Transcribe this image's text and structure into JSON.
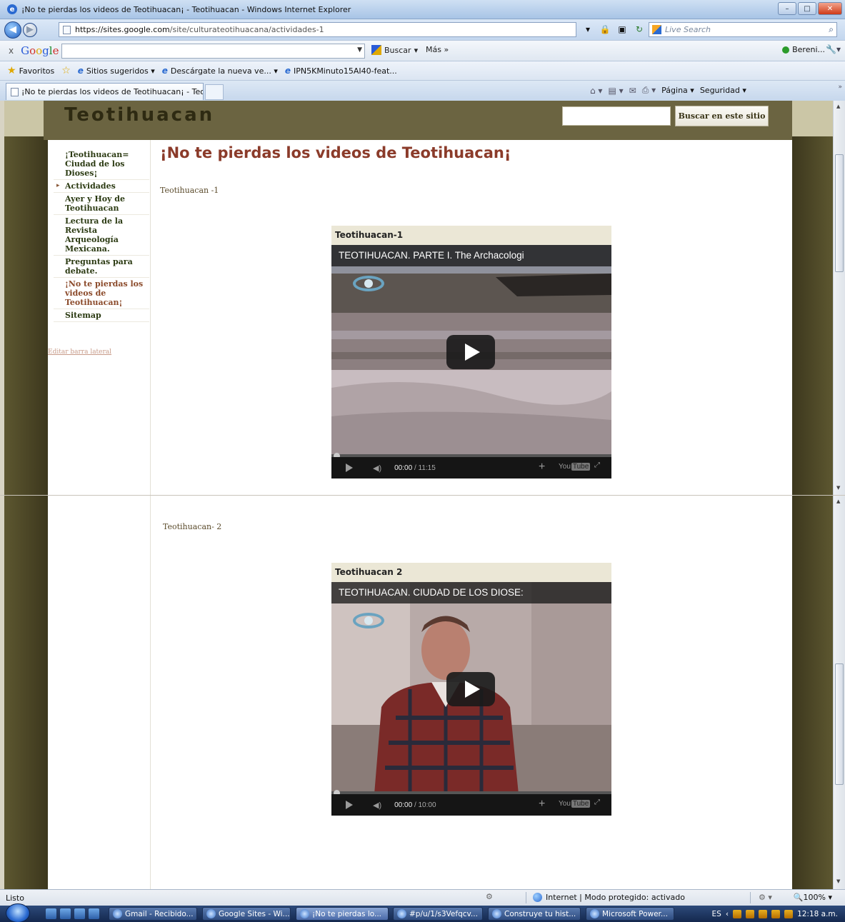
{
  "window": {
    "title": "¡No te pierdas los videos de Teotihuacan¡ - Teotihuacan - Windows Internet Explorer",
    "minimize": "–",
    "maximize": "□",
    "close": "✕"
  },
  "address": {
    "host": "https://sites.google.com",
    "path": "/site/culturateotihuacana/actividades-1",
    "live_search_placeholder": "Live Search"
  },
  "google_toolbar": {
    "close": "x",
    "logo": [
      "G",
      "o",
      "o",
      "g",
      "l",
      "e"
    ],
    "search_button": "Buscar",
    "more": "Más »",
    "user": "Bereni..."
  },
  "favorites": {
    "favorites_label": "Favoritos",
    "items": [
      "Sitios sugeridos ▾",
      "Descárgate la nueva ve... ▾",
      "IPN5KMinuto15AI40-feat..."
    ]
  },
  "tab": {
    "label": "¡No te pierdas los videos de Teotihuacan¡ - Teoti...",
    "commands": [
      "Página ▾",
      "Seguridad ▾"
    ]
  },
  "site": {
    "title": "Teotihuacan",
    "search_button": "Buscar en este sitio",
    "nav": [
      "¡Teotihuacan= Ciudad de los Dioses¡",
      "Actividades",
      "Ayer y Hoy de Teotihuacan",
      "Lectura de la Revista Arqueología Mexicana.",
      "Preguntas para debate.",
      "¡No te pierdas los videos de Teotihuacan¡",
      "Sitemap"
    ],
    "edit_sidebar": "Editar barra lateral",
    "page_title": "¡No te pierdas los videos de Teotihuacan¡",
    "section1": "Teotihuacan -1",
    "section2": "Teotihuacan- 2"
  },
  "videos": [
    {
      "caption": "Teotihuacan-1",
      "title": "TEOTIHUACAN. PARTE I. The Archacologi",
      "time_current": "00:00",
      "time_total": "/ 11:15",
      "youtube": "You",
      "youtube_tube": "Tube"
    },
    {
      "caption": "Teotihuacan 2",
      "title": "TEOTIHUACAN. CIUDAD DE LOS DIOSE:",
      "time_current": "00:00",
      "time_total": "/ 10:00",
      "youtube": "You",
      "youtube_tube": "Tube"
    }
  ],
  "status": {
    "left": "Listo",
    "zone": "Internet | Modo protegido: activado",
    "zoom": "100% ▾"
  },
  "taskbar": {
    "items": [
      "Gmail - Recibido...",
      "Google Sites - Wi...",
      "¡No te pierdas lo...",
      "#p/u/1/s3Vefqcv...",
      "Construye tu hist...",
      "Microsoft Power..."
    ],
    "lang": "ES",
    "clock": "12:18 a.m."
  }
}
